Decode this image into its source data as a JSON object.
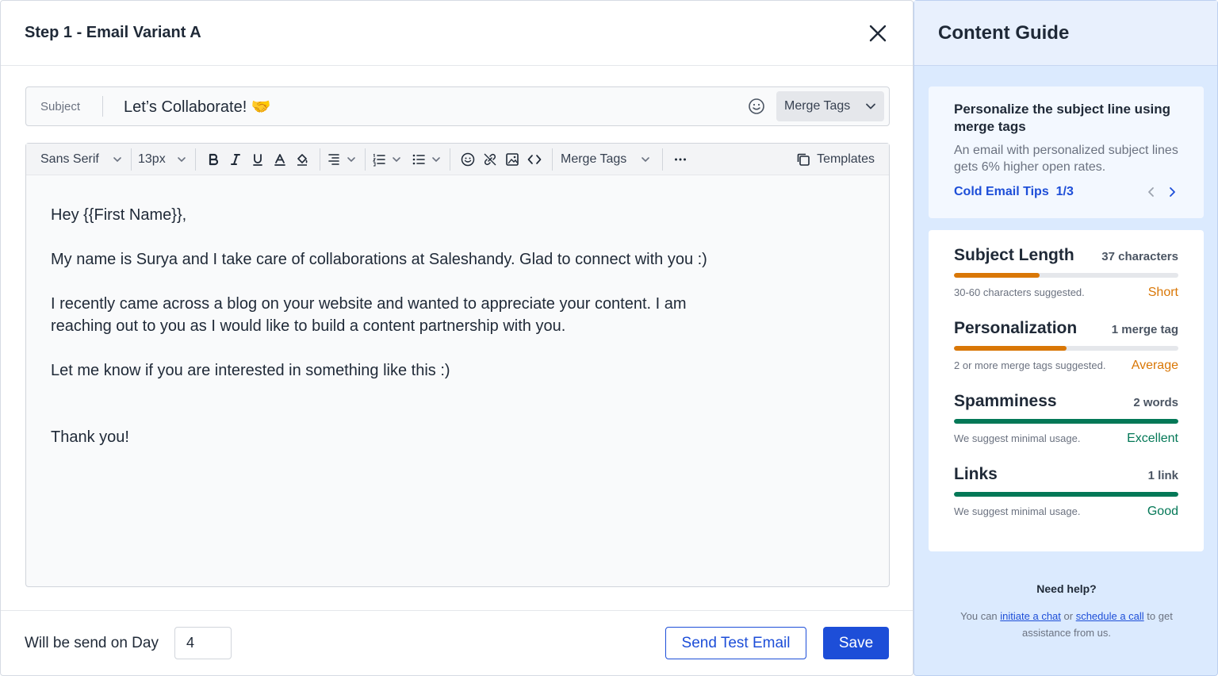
{
  "modal": {
    "title": "Step 1 - Email Variant A"
  },
  "subject": {
    "label": "Subject",
    "value": "Let’s Collaborate! 🤝",
    "merge_tags_label": "Merge Tags"
  },
  "toolbar": {
    "font_family": "Sans Serif",
    "font_size": "13px",
    "merge_tags_label": "Merge Tags",
    "templates_label": "Templates"
  },
  "email_body": {
    "greeting": "Hey {{First Name}},",
    "para1": "My name is Surya and I take care of collaborations at Saleshandy. Glad to connect with you :)",
    "para2_line1": "I recently came across a blog on your website and wanted to appreciate your content. I am",
    "para2_line2": "reaching out to you as I would like to build a content partnership with you.",
    "para3": "Let me know if you are interested in something like this :)",
    "signoff": "Thank you!"
  },
  "footer": {
    "day_label": "Will be send on Day",
    "day_value": "4",
    "send_test_label": "Send Test Email",
    "save_label": "Save"
  },
  "guide": {
    "title": "Content Guide",
    "tip": {
      "title": "Personalize the subject line using merge tags",
      "description": "An email with personalized subject lines gets 6% higher open rates.",
      "link": "Cold Email Tips  1/3"
    },
    "metrics": [
      {
        "name": "Subject Length",
        "count": "37 characters",
        "hint": "30-60 characters suggested.",
        "rating": "Short",
        "progress": 0.38,
        "color": "#d97706",
        "rating_color": "#d97706"
      },
      {
        "name": "Personalization",
        "count": "1 merge tag",
        "hint": "2 or more merge tags suggested.",
        "rating": "Average",
        "progress": 0.5,
        "color": "#d97706",
        "rating_color": "#d97706"
      },
      {
        "name": "Spamminess",
        "count": "2 words",
        "hint": "We suggest minimal usage.",
        "rating": "Excellent",
        "progress": 1.0,
        "color": "#047857",
        "rating_color": "#047857"
      },
      {
        "name": "Links",
        "count": "1 link",
        "hint": "We suggest minimal usage.",
        "rating": "Good",
        "progress": 1.0,
        "color": "#047857",
        "rating_color": "#047857"
      }
    ],
    "help": {
      "title": "Need help?",
      "prefix": "You can ",
      "chat_link": "initiate a chat",
      "middle": " or ",
      "call_link": "schedule a call",
      "suffix": " to get assistance from us."
    }
  },
  "colors": {
    "primary": "#1d4ed8",
    "guide_bg": "#dbeafe"
  }
}
